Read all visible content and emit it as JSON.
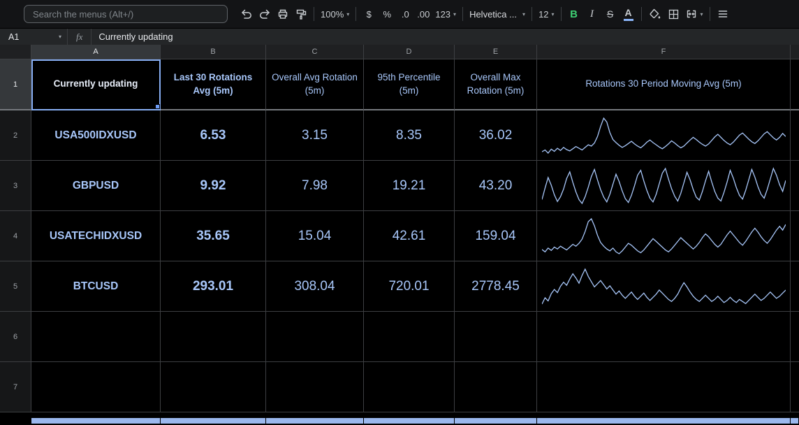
{
  "toolbar": {
    "search_placeholder": "Search the menus (Alt+/)",
    "zoom_value": "100%",
    "format_currency": "$",
    "format_percent": "%",
    "decrease_decimal": ".0",
    "increase_decimal": ".00",
    "more_formats": "123",
    "font_family": "Helvetica ...",
    "font_size": "12",
    "bold": "B",
    "italic": "I",
    "strikethrough": "S",
    "text_color": "A"
  },
  "formula_bar": {
    "cell_reference": "A1",
    "fx_label": "fx",
    "content": "Currently updating"
  },
  "sheet": {
    "col_headers": [
      "A",
      "B",
      "C",
      "D",
      "E",
      "F"
    ],
    "rows": [
      {
        "n": "1",
        "cells": [
          "Currently updating",
          "Last 30 Rotations Avg (5m)",
          "Overall Avg Rotation (5m)",
          "95th Percentile (5m)",
          "Overall Max Rotation (5m)",
          "Rotations 30 Period Moving Avg (5m)"
        ]
      },
      {
        "n": "2",
        "cells": [
          "USA500IDXUSD",
          "6.53",
          "3.15",
          "8.35",
          "36.02"
        ]
      },
      {
        "n": "3",
        "cells": [
          "GBPUSD",
          "9.92",
          "7.98",
          "19.21",
          "43.20"
        ]
      },
      {
        "n": "4",
        "cells": [
          "USATECHIDXUSD",
          "35.65",
          "15.04",
          "42.61",
          "159.04"
        ]
      },
      {
        "n": "5",
        "cells": [
          "BTCUSD",
          "293.01",
          "308.04",
          "720.01",
          "2778.45"
        ]
      },
      {
        "n": "6",
        "cells": [
          "",
          "",
          "",
          "",
          "",
          ""
        ]
      },
      {
        "n": "7",
        "cells": [
          "",
          "",
          "",
          "",
          "",
          ""
        ]
      }
    ]
  },
  "colors": {
    "background": "#000000",
    "toolbar_background": "#131416",
    "panel_background": "#242628",
    "gridline": "#3d3f42",
    "cell_text": "#a8c7fa",
    "selection_border": "#87aef3",
    "frozen_divider": "#75797e",
    "bold_active_green": "#3ecf73",
    "text_color_underline": "#8ab4f8",
    "sparkline": "#a8c7fa",
    "bottom_band": "#9bb8ee"
  },
  "chart_data": {
    "type": "line",
    "title": "Rotations 30 Period Moving Avg (5m)",
    "note": "In-cell sparklines, one per instrument row; unlabeled axes, values estimated 0-100 relative scale",
    "sparklines": [
      {
        "name": "USA500IDXUSD",
        "values": [
          20,
          24,
          17,
          26,
          21,
          28,
          23,
          30,
          25,
          22,
          27,
          32,
          28,
          24,
          30,
          36,
          33,
          40,
          55,
          78,
          97,
          88,
          64,
          48,
          41,
          35,
          30,
          34,
          39,
          44,
          38,
          33,
          29,
          35,
          42,
          47,
          41,
          36,
          31,
          27,
          32,
          38,
          45,
          40,
          34,
          29,
          33,
          40,
          47,
          53,
          48,
          42,
          37,
          33,
          38,
          46,
          54,
          60,
          53,
          46,
          40,
          36,
          42,
          50,
          58,
          63,
          56,
          49,
          43,
          39,
          45,
          53,
          61,
          66,
          59,
          52,
          47,
          53,
          62,
          55
        ]
      },
      {
        "name": "GBPUSD",
        "values": [
          28,
          52,
          74,
          58,
          38,
          24,
          34,
          50,
          72,
          86,
          64,
          44,
          28,
          20,
          34,
          54,
          76,
          91,
          69,
          49,
          33,
          23,
          39,
          60,
          81,
          66,
          46,
          30,
          22,
          37,
          57,
          79,
          89,
          67,
          47,
          31,
          23,
          39,
          61,
          83,
          93,
          71,
          51,
          35,
          25,
          41,
          63,
          85,
          69,
          49,
          33,
          27,
          45,
          67,
          87,
          65,
          45,
          31,
          25,
          43,
          65,
          89,
          73,
          53,
          37,
          29,
          47,
          69,
          91,
          75,
          55,
          39,
          31,
          49,
          71,
          93,
          79,
          59,
          45,
          68
        ]
      },
      {
        "name": "USATECHIDXUSD",
        "values": [
          34,
          29,
          37,
          32,
          39,
          35,
          41,
          37,
          33,
          39,
          45,
          41,
          47,
          56,
          72,
          93,
          99,
          84,
          64,
          49,
          41,
          35,
          31,
          37,
          29,
          25,
          31,
          39,
          47,
          43,
          37,
          31,
          27,
          33,
          41,
          49,
          57,
          51,
          45,
          39,
          33,
          29,
          35,
          43,
          51,
          59,
          53,
          47,
          41,
          35,
          41,
          49,
          59,
          67,
          61,
          53,
          45,
          39,
          45,
          55,
          65,
          73,
          65,
          57,
          49,
          43,
          51,
          61,
          71,
          79,
          71,
          61,
          53,
          47,
          55,
          65,
          75,
          83,
          75,
          87
        ]
      },
      {
        "name": "BTCUSD",
        "values": [
          28,
          40,
          34,
          48,
          56,
          50,
          62,
          70,
          64,
          76,
          86,
          78,
          68,
          83,
          95,
          81,
          71,
          61,
          67,
          73,
          65,
          57,
          63,
          55,
          47,
          53,
          45,
          39,
          45,
          51,
          43,
          37,
          43,
          49,
          41,
          35,
          41,
          47,
          55,
          49,
          43,
          37,
          33,
          39,
          47,
          59,
          69,
          61,
          51,
          43,
          37,
          33,
          39,
          45,
          39,
          33,
          37,
          43,
          37,
          31,
          35,
          41,
          35,
          31,
          37,
          33,
          29,
          35,
          41,
          47,
          41,
          35,
          39,
          45,
          51,
          45,
          39,
          43,
          49,
          55
        ]
      }
    ]
  }
}
